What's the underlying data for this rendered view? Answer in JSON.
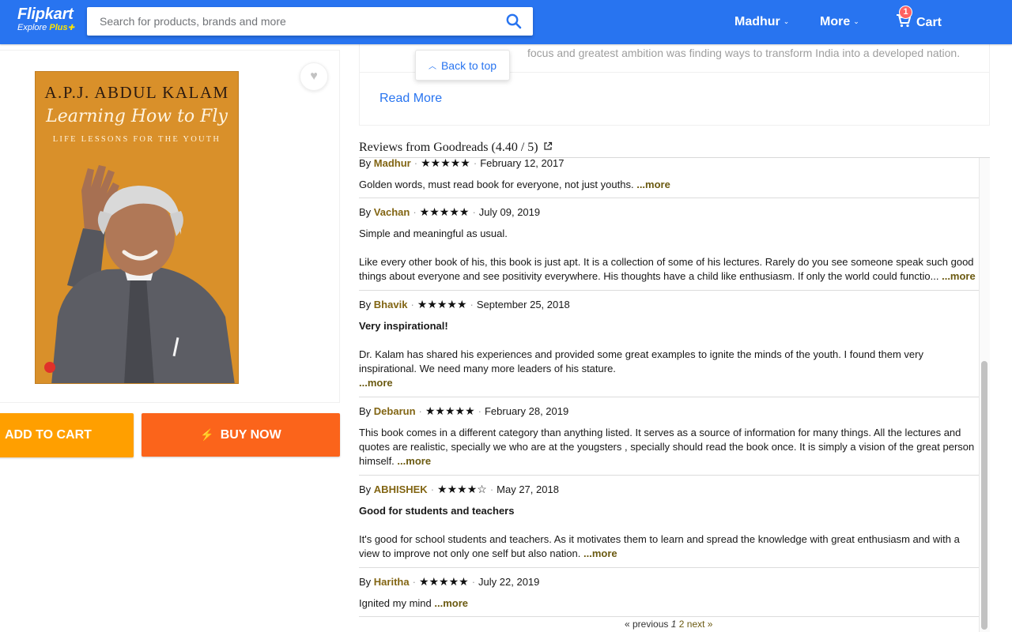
{
  "header": {
    "logo": "Flipkart",
    "logo_sub_explore": "Explore",
    "logo_sub_plus": "Plus",
    "search_placeholder": "Search for products, brands and more",
    "user": "Madhur",
    "more": "More",
    "cart": "Cart",
    "cart_count": "1"
  },
  "book_cover": {
    "author": "A.P.J. ABDUL KALAM",
    "title": "Learning How to Fly",
    "subtitle": "LIFE LESSONS FOR THE YOUTH"
  },
  "buttons": {
    "add_to_cart": "ADD TO CART",
    "buy_now": "BUY NOW"
  },
  "description": {
    "text": "focus and greatest ambition was finding ways to transform India into a developed nation.",
    "read_more": "Read More",
    "back_to_top": "Back to top"
  },
  "reviews": {
    "heading": "Reviews from Goodreads (4.40 / 5)",
    "items": [
      {
        "by": "By",
        "user": "Madhur",
        "stars": "★★★★★",
        "date": "February 12, 2017",
        "title": "",
        "body": [
          "Golden words, must read book for everyone, not just youths."
        ],
        "more": "...more"
      },
      {
        "by": "By",
        "user": "Vachan",
        "stars": "★★★★★",
        "date": "July 09, 2019",
        "title": "",
        "body": [
          "Simple and meaningful as usual.",
          "Like every other book of his, this book is just apt. It is a collection of some of his lectures. Rarely do you see someone speak such good things about everyone and see positivity everywhere. His thoughts have a child like enthusiasm. If only the world could functio..."
        ],
        "more": "...more"
      },
      {
        "by": "By",
        "user": "Bhavik",
        "stars": "★★★★★",
        "date": "September 25, 2018",
        "title": "Very inspirational!",
        "body": [
          "Dr. Kalam has shared his experiences and provided some great examples to ignite the minds of the youth. I found them very inspirational. We need many more leaders of his stature."
        ],
        "more": "...more"
      },
      {
        "by": "By",
        "user": "Debarun",
        "stars": "★★★★★",
        "date": "February 28, 2019",
        "title": "",
        "body": [
          "This book comes in a different category than anything listed. It serves as a source of information for many things. All the lectures and quotes are realistic, specially we who are at the yougsters , specially should read the book once. It is simply a vision of the great person himself."
        ],
        "more": "...more"
      },
      {
        "by": "By",
        "user": "ABHISHEK",
        "stars": "★★★★☆",
        "date": "May 27, 2018",
        "title": "Good for students and teachers",
        "body": [
          "It's good for school students and teachers. As it motivates them to learn and spread the knowledge with great enthusiasm and with a view to improve not only one self but also nation."
        ],
        "more": "...more"
      },
      {
        "by": "By",
        "user": "Haritha",
        "stars": "★★★★★",
        "date": "July 22, 2019",
        "title": "",
        "body": [
          "Ignited my mind"
        ],
        "more": "...more"
      }
    ],
    "pager": {
      "prev": "« previous",
      "page1": "1",
      "page2": "2",
      "next": "next »"
    }
  },
  "colors": {
    "brand_blue": "#2874f0",
    "add_to_cart": "#ff9f00",
    "buy_now": "#fb641b",
    "username": "#826513"
  }
}
